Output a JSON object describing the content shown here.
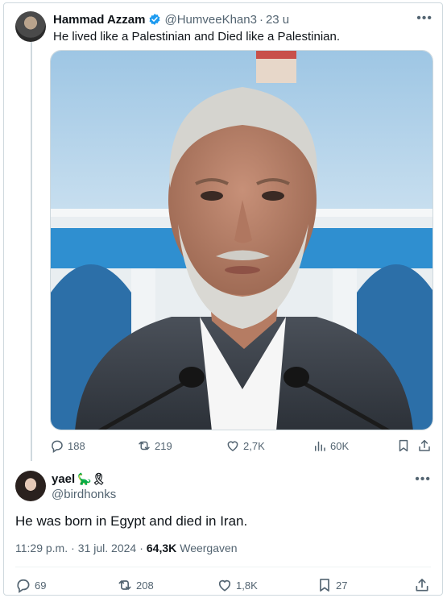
{
  "tweet": {
    "author_name": "Hammad Azzam",
    "handle": "@HumveeKhan3",
    "dot": "·",
    "time": "23 u",
    "text": "He lived like a Palestinian and Died like a Palestinian.",
    "more_icon": "more-dots-icon",
    "stats": {
      "replies": "188",
      "reposts": "219",
      "likes": "2,7K",
      "views": "60K"
    }
  },
  "reply": {
    "author_name": "yael",
    "emoji": "🦕🎗",
    "handle": "@birdhonks",
    "text": "He was born in Egypt and died in Iran.",
    "time": "11:29 p.m.",
    "sep": "·",
    "date": "31 jul. 2024",
    "sep2": "·",
    "views": "64,3K",
    "views_label": "Weergaven",
    "stats": {
      "replies": "69",
      "reposts": "208",
      "likes": "1,8K",
      "bookmarks": "27"
    }
  },
  "colors": {
    "text": "#0f1419",
    "secondary": "#536471",
    "verified": "#1d9bf0",
    "border": "#cfd9de"
  }
}
